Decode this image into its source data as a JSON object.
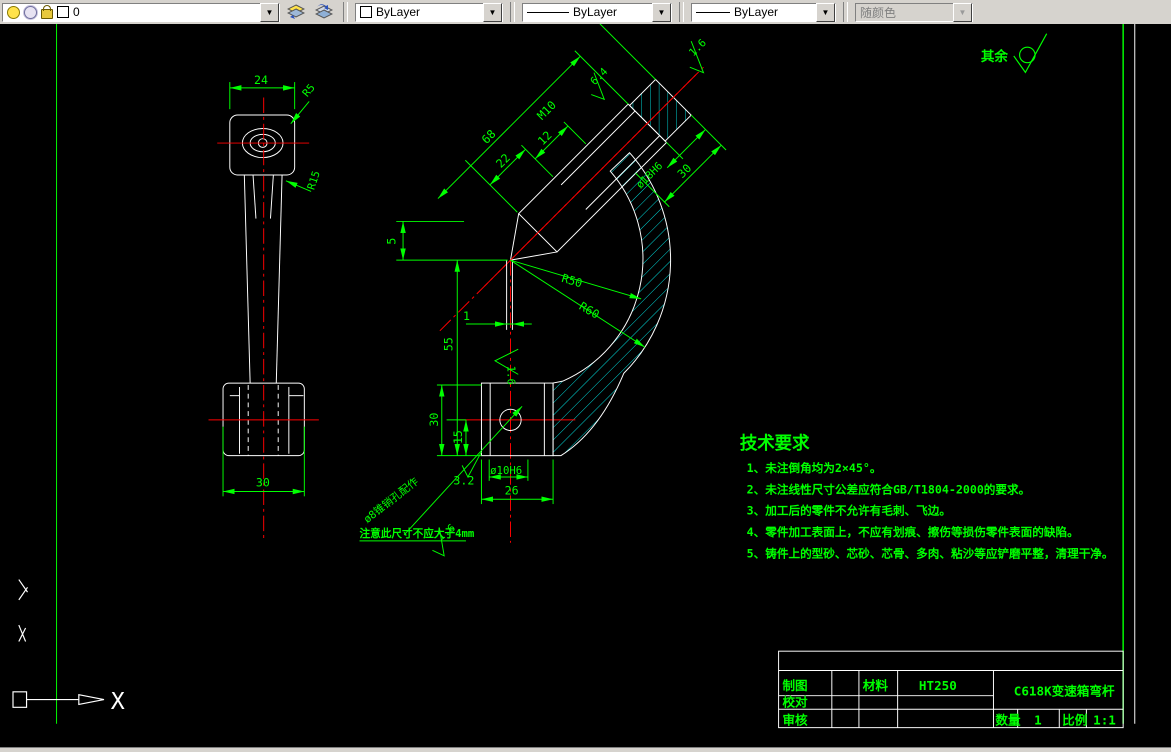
{
  "toolbar": {
    "layer_value": "0",
    "color_value": "ByLayer",
    "linetype_value": "ByLayer",
    "lineweight_value": "ByLayer",
    "plot_style_value": "随颜色"
  },
  "surface_default": {
    "label": "其余"
  },
  "tech": {
    "title": "技术要求",
    "items": [
      "1、未注倒角均为2×45°。",
      "2、未注线性尺寸公差应符合GB/T1804-2000的要求。",
      "3、加工后的零件不允许有毛刺、飞边。",
      "4、零件加工表面上，不应有划痕、擦伤等损伤零件表面的缺陷。",
      "5、铸件上的型砂、芯砂、芯骨、多肉、粘沙等应铲磨平整，清理干净。"
    ]
  },
  "title_block": {
    "drawn_label": "制图",
    "check_label": "校对",
    "review_label": "审核",
    "material_label": "材料",
    "material_value": "HT250",
    "part_title": "C618K变速箱弯杆",
    "qty_label": "数量",
    "qty_value": "1",
    "scale_label": "比例",
    "scale_value": "1:1"
  },
  "left_view": {
    "width_top": "24",
    "fillet_top": "R5",
    "fillet_mid": "R15",
    "width_bottom": "30"
  },
  "main_view": {
    "d22": "22",
    "d12": "12",
    "d68": "68",
    "thread": "M10",
    "boss_len": "30",
    "bore": "ø18H6",
    "ra_boss": "6.4",
    "ra_end": "1.6",
    "ra_step": "1.6",
    "d5": "5",
    "r_inner": "R50",
    "r_outer": "R60",
    "d55": "55",
    "d1": "1",
    "block_h": "30",
    "d15": "15",
    "ra_hole": "3.2",
    "ra_pin": "1.6",
    "hole": "ø10H6",
    "d26": "26",
    "pin_note": "ø8锥销孔配作",
    "caution": "注意此尺寸不应大于4mm"
  },
  "ucs": {
    "x_label": "X"
  }
}
